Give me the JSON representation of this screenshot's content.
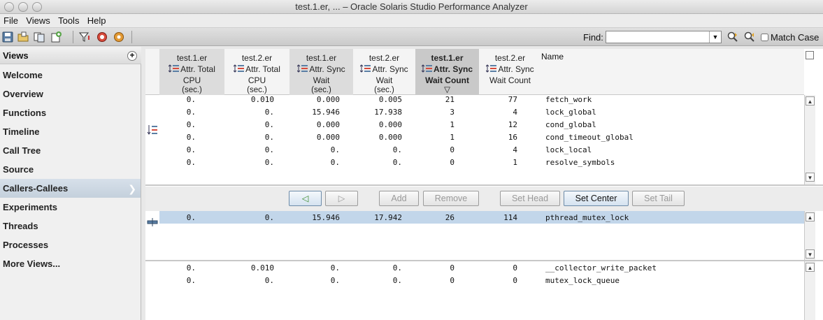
{
  "window": {
    "title": "test.1.er, ...  –  Oracle Solaris Studio Performance Analyzer"
  },
  "menu": [
    "File",
    "Views",
    "Tools",
    "Help"
  ],
  "toolbar": {
    "icons": [
      "save-icon",
      "open-icon",
      "compare-icon",
      "add-experiment-icon",
      "filter-icon",
      "collect-icon",
      "settings-icon"
    ],
    "find_label": "Find:",
    "find_value": "",
    "match_case_label": "Match Case"
  },
  "sidebar": {
    "header": "Views",
    "items": [
      {
        "label": "Welcome"
      },
      {
        "label": "Overview"
      },
      {
        "label": "Functions"
      },
      {
        "label": "Timeline"
      },
      {
        "label": "Call Tree"
      },
      {
        "label": "Source"
      },
      {
        "label": "Callers-Callees",
        "selected": true
      },
      {
        "label": "Experiments"
      },
      {
        "label": "Threads"
      },
      {
        "label": "Processes"
      },
      {
        "label": "More Views..."
      }
    ]
  },
  "columns": [
    {
      "exp": "test.1.er",
      "l1": "Attr. Total",
      "l2": "CPU",
      "l3": "(sec.)"
    },
    {
      "exp": "test.2.er",
      "l1": "Attr. Total",
      "l2": "CPU",
      "l3": "(sec.)"
    },
    {
      "exp": "test.1.er",
      "l1": "Attr. Sync",
      "l2": "Wait",
      "l3": "(sec.)"
    },
    {
      "exp": "test.2.er",
      "l1": "Attr. Sync",
      "l2": "Wait",
      "l3": "(sec.)"
    },
    {
      "exp": "test.1.er",
      "l1": "Attr. Sync",
      "l2": "Wait Count",
      "l3": "▽"
    },
    {
      "exp": "test.2.er",
      "l1": "Attr. Sync",
      "l2": "Wait Count",
      "l3": ""
    }
  ],
  "name_header": "Name",
  "callers": [
    [
      "0.",
      "0.010",
      "0.000",
      "0.005",
      "21",
      "77",
      "fetch_work"
    ],
    [
      "0.",
      "0.",
      "15.946",
      "17.938",
      "3",
      "4",
      "lock_global"
    ],
    [
      "0.",
      "0.",
      "0.000",
      "0.000",
      "1",
      "12",
      "cond_global"
    ],
    [
      "0.",
      "0.",
      "0.000",
      "0.000",
      "1",
      "16",
      "cond_timeout_global"
    ],
    [
      "0.",
      "0.",
      "0.",
      "0.",
      "0",
      "4",
      "lock_local"
    ],
    [
      "0.",
      "0.",
      "0.",
      "0.",
      "0",
      "1",
      "resolve_symbols"
    ]
  ],
  "buttons": {
    "back": "◁",
    "forward": "▷",
    "add": "Add",
    "remove": "Remove",
    "set_head": "Set Head",
    "set_center": "Set Center",
    "set_tail": "Set Tail"
  },
  "center": [
    "0.",
    "0.",
    "15.946",
    "17.942",
    "26",
    "114",
    "pthread_mutex_lock"
  ],
  "callees": [
    [
      "0.",
      "0.010",
      "0.",
      "0.",
      "0",
      "0",
      "__collector_write_packet"
    ],
    [
      "0.",
      "0.",
      "0.",
      "0.",
      "0",
      "0",
      "mutex_lock_queue"
    ]
  ],
  "colors": {
    "selected_row": "#c2d6ea",
    "sorted_header": "#c9c9c9",
    "accent": "#6d8ba8"
  }
}
